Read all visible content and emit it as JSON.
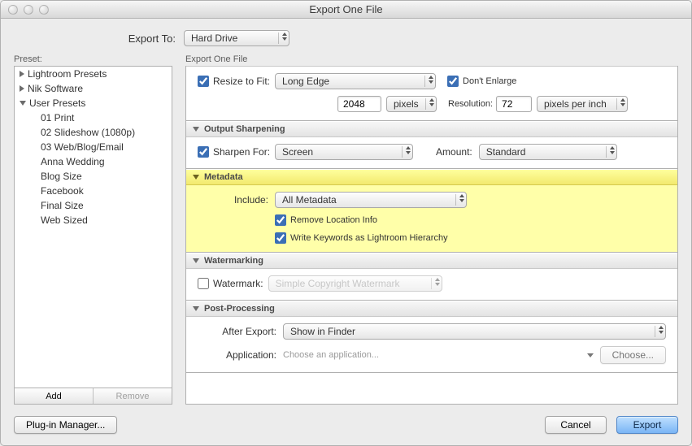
{
  "window": {
    "title": "Export One File"
  },
  "exportTo": {
    "label": "Export To:",
    "value": "Hard Drive"
  },
  "sidebar": {
    "label": "Preset:",
    "groups": [
      {
        "name": "Lightroom Presets",
        "expanded": false
      },
      {
        "name": "Nik Software",
        "expanded": false
      },
      {
        "name": "User Presets",
        "expanded": true
      }
    ],
    "userPresets": [
      "01 Print",
      "02 Slideshow (1080p)",
      "03 Web/Blog/Email",
      "Anna Wedding",
      "Blog Size",
      "Facebook",
      "Final Size",
      "Web Sized"
    ],
    "buttons": {
      "add": "Add",
      "remove": "Remove"
    }
  },
  "right": {
    "label": "Export One File",
    "resize": {
      "checkboxLabel": "Resize to Fit:",
      "checked": true,
      "mode": "Long Edge",
      "dontEnlargeLabel": "Don't Enlarge",
      "dontEnlargeChecked": true,
      "value": "2048",
      "unit": "pixels",
      "resolutionLabel": "Resolution:",
      "resolutionValue": "72",
      "resolutionUnit": "pixels per inch"
    },
    "sharpen": {
      "header": "Output Sharpening",
      "checkboxLabel": "Sharpen For:",
      "checked": true,
      "target": "Screen",
      "amountLabel": "Amount:",
      "amount": "Standard"
    },
    "metadata": {
      "header": "Metadata",
      "includeLabel": "Include:",
      "includeValue": "All Metadata",
      "removeLocationLabel": "Remove Location Info",
      "removeLocationChecked": true,
      "keywordsLabel": "Write Keywords as Lightroom Hierarchy",
      "keywordsChecked": true
    },
    "watermark": {
      "header": "Watermarking",
      "checkboxLabel": "Watermark:",
      "checked": false,
      "value": "Simple Copyright Watermark"
    },
    "post": {
      "header": "Post-Processing",
      "afterLabel": "After Export:",
      "afterValue": "Show in Finder",
      "appLabel": "Application:",
      "appPlaceholder": "Choose an application...",
      "chooseBtn": "Choose..."
    }
  },
  "footer": {
    "pluginManager": "Plug-in Manager...",
    "cancel": "Cancel",
    "export": "Export"
  }
}
